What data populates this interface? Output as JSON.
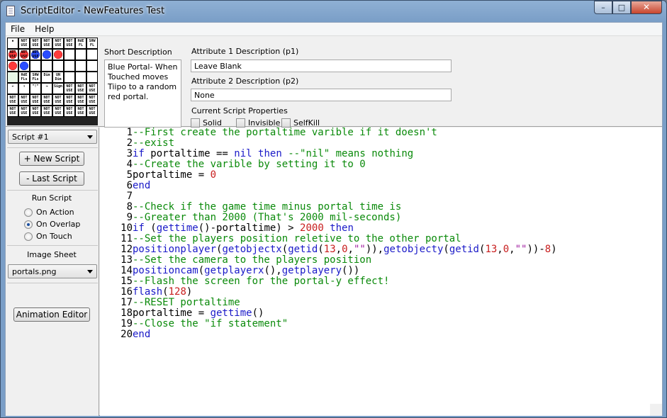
{
  "window": {
    "title": "ScriptEditor - NewFeatures Test",
    "buttons": {
      "minimize": "–",
      "maximize": "□",
      "close": "✕"
    }
  },
  "menu": [
    "File",
    "Help"
  ],
  "palette": [
    [
      "▪",
      "NOT USE",
      "NOT USE",
      "NOT USE",
      "NOT USE",
      "NOT USE",
      "HdE FL",
      "SHW FL"
    ],
    [
      "NOT USE",
      "NOT USE",
      "NOT USE",
      "",
      "",
      "",
      "",
      ""
    ],
    [
      "",
      "",
      "",
      "",
      "",
      "",
      "",
      ""
    ],
    [
      "",
      "HdE FLs",
      "SHW FLs",
      "Dim",
      "UN Dim",
      "",
      "",
      ""
    ],
    [
      "←",
      "↑",
      "\"!\"",
      "→",
      "Sign",
      "NOT USE",
      "NOT USE",
      "NOT USE"
    ],
    [
      "NOT USE",
      "NOT USE",
      "NOT USE",
      "NOT USE",
      "NOT USE",
      "NOT USE",
      "NOT USE",
      "NOT USE"
    ],
    [
      "NOT USE",
      "NOT USE",
      "NOT USE",
      "NOT USE",
      "NOT USE",
      "NOT USE",
      "NOT USE",
      "NOT USE"
    ]
  ],
  "short_description": {
    "label": "Short Description",
    "text": "Blue Portal- When\nTouched moves\nTiipo to a random\nred portal."
  },
  "attribute1": {
    "label": "Attribute 1 Description (p1)",
    "value": "Leave Blank"
  },
  "attribute2": {
    "label": "Attribute 2 Description (p2)",
    "value": "None"
  },
  "properties": {
    "label": "Current Script Properties",
    "items": [
      "Solid",
      "Invisible",
      "SelfKill"
    ]
  },
  "sidebar": {
    "script_select": "Script #1",
    "new_script": "+ New Script",
    "last_script": "- Last Script",
    "run_script_label": "Run Script",
    "run_options": [
      "On Action",
      "On Overlap",
      "On Touch"
    ],
    "run_selected": "On Overlap",
    "image_sheet_label": "Image Sheet",
    "image_sheet_select": "portals.png",
    "animation_editor": "Animation Editor"
  },
  "code_lines": [
    "--First create the portaltime varible if it doesn't",
    "--exist",
    "if portaltime == nil then --\"nil\" means nothing",
    "--Create the varible by setting it to 0",
    "portaltime = 0",
    "end",
    "",
    "--Check if the game time minus portal time is",
    "--Greater than 2000 (That's 2000 mil-seconds)",
    "if (gettime()-portaltime) > 2000 then",
    "--Set the players position reletive to the other portal",
    "positionplayer(getobjectx(getid(13,0,\"\")),getobjecty(getid(13,0,\"\"))-8)",
    "--Set the camera to the players position",
    "positioncam(getplayerx(),getplayery())",
    "--Flash the screen for the portal-y effect!",
    "flash(128)",
    "--RESET portaltime",
    "portaltime = gettime()",
    "--Close the \"if statement\"",
    "end"
  ]
}
